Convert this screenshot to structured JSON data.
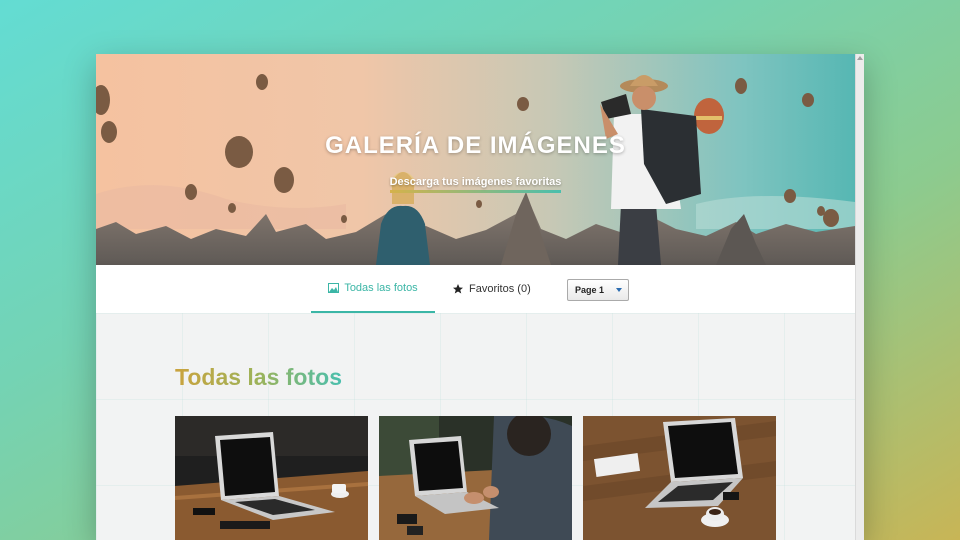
{
  "hero": {
    "title": "GALERÍA DE IMÁGENES",
    "subtitle": "Descarga tus imágenes favoritas"
  },
  "nav": {
    "tabs": [
      {
        "label": "Todas las fotos",
        "icon": "image-icon",
        "active": true
      },
      {
        "label": "Favoritos (0)",
        "icon": "star-icon",
        "active": false
      }
    ],
    "page_select": {
      "value": "Page 1"
    }
  },
  "main": {
    "section_title": "Todas las fotos",
    "photos": [
      {
        "subject": "laptop-on-wooden-table"
      },
      {
        "subject": "person-typing-on-laptop"
      },
      {
        "subject": "laptop-with-notebook-and-coffee"
      }
    ]
  },
  "colors": {
    "accent_teal": "#3bb6a6",
    "accent_gold": "#caa33e"
  }
}
